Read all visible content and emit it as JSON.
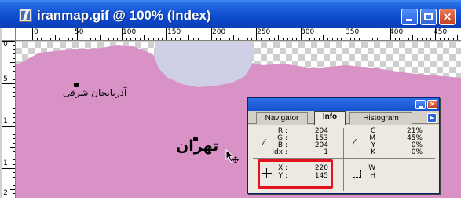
{
  "window": {
    "title": "iranmap.gif @ 100% (Index)",
    "buttons": {
      "minimize": "minimize",
      "maximize": "maximize",
      "close": "×"
    }
  },
  "ruler": {
    "top": [
      "0",
      "50",
      "100",
      "150",
      "200",
      "250",
      "300",
      "350",
      "400",
      "450"
    ],
    "left": [
      "0",
      "5",
      "1",
      "1",
      "2"
    ]
  },
  "map": {
    "colors": {
      "land": "#d992c6",
      "region": "#cfcfe6",
      "border": "#c9c9df"
    },
    "cities": {
      "azerbaijan_east": "آذربایجان شرقی",
      "tehran": "تهران"
    }
  },
  "palette": {
    "tabs": [
      "Navigator",
      "Info",
      "Histogram"
    ],
    "active_tab": "Info",
    "rgb": [
      {
        "label": "R :",
        "value": "204"
      },
      {
        "label": "G :",
        "value": "153"
      },
      {
        "label": "B :",
        "value": "204"
      },
      {
        "label": "Idx :",
        "value": "1"
      }
    ],
    "cmyk": [
      {
        "label": "C :",
        "value": "21%"
      },
      {
        "label": "M :",
        "value": "45%"
      },
      {
        "label": "Y :",
        "value": "0%"
      },
      {
        "label": "K :",
        "value": "0%"
      }
    ],
    "xy": [
      {
        "label": "X :",
        "value": "220"
      },
      {
        "label": "Y :",
        "value": "145"
      }
    ],
    "wh": [
      {
        "label": "W :",
        "value": ""
      },
      {
        "label": "H :",
        "value": ""
      }
    ],
    "highlight_color": "#e3121f"
  }
}
